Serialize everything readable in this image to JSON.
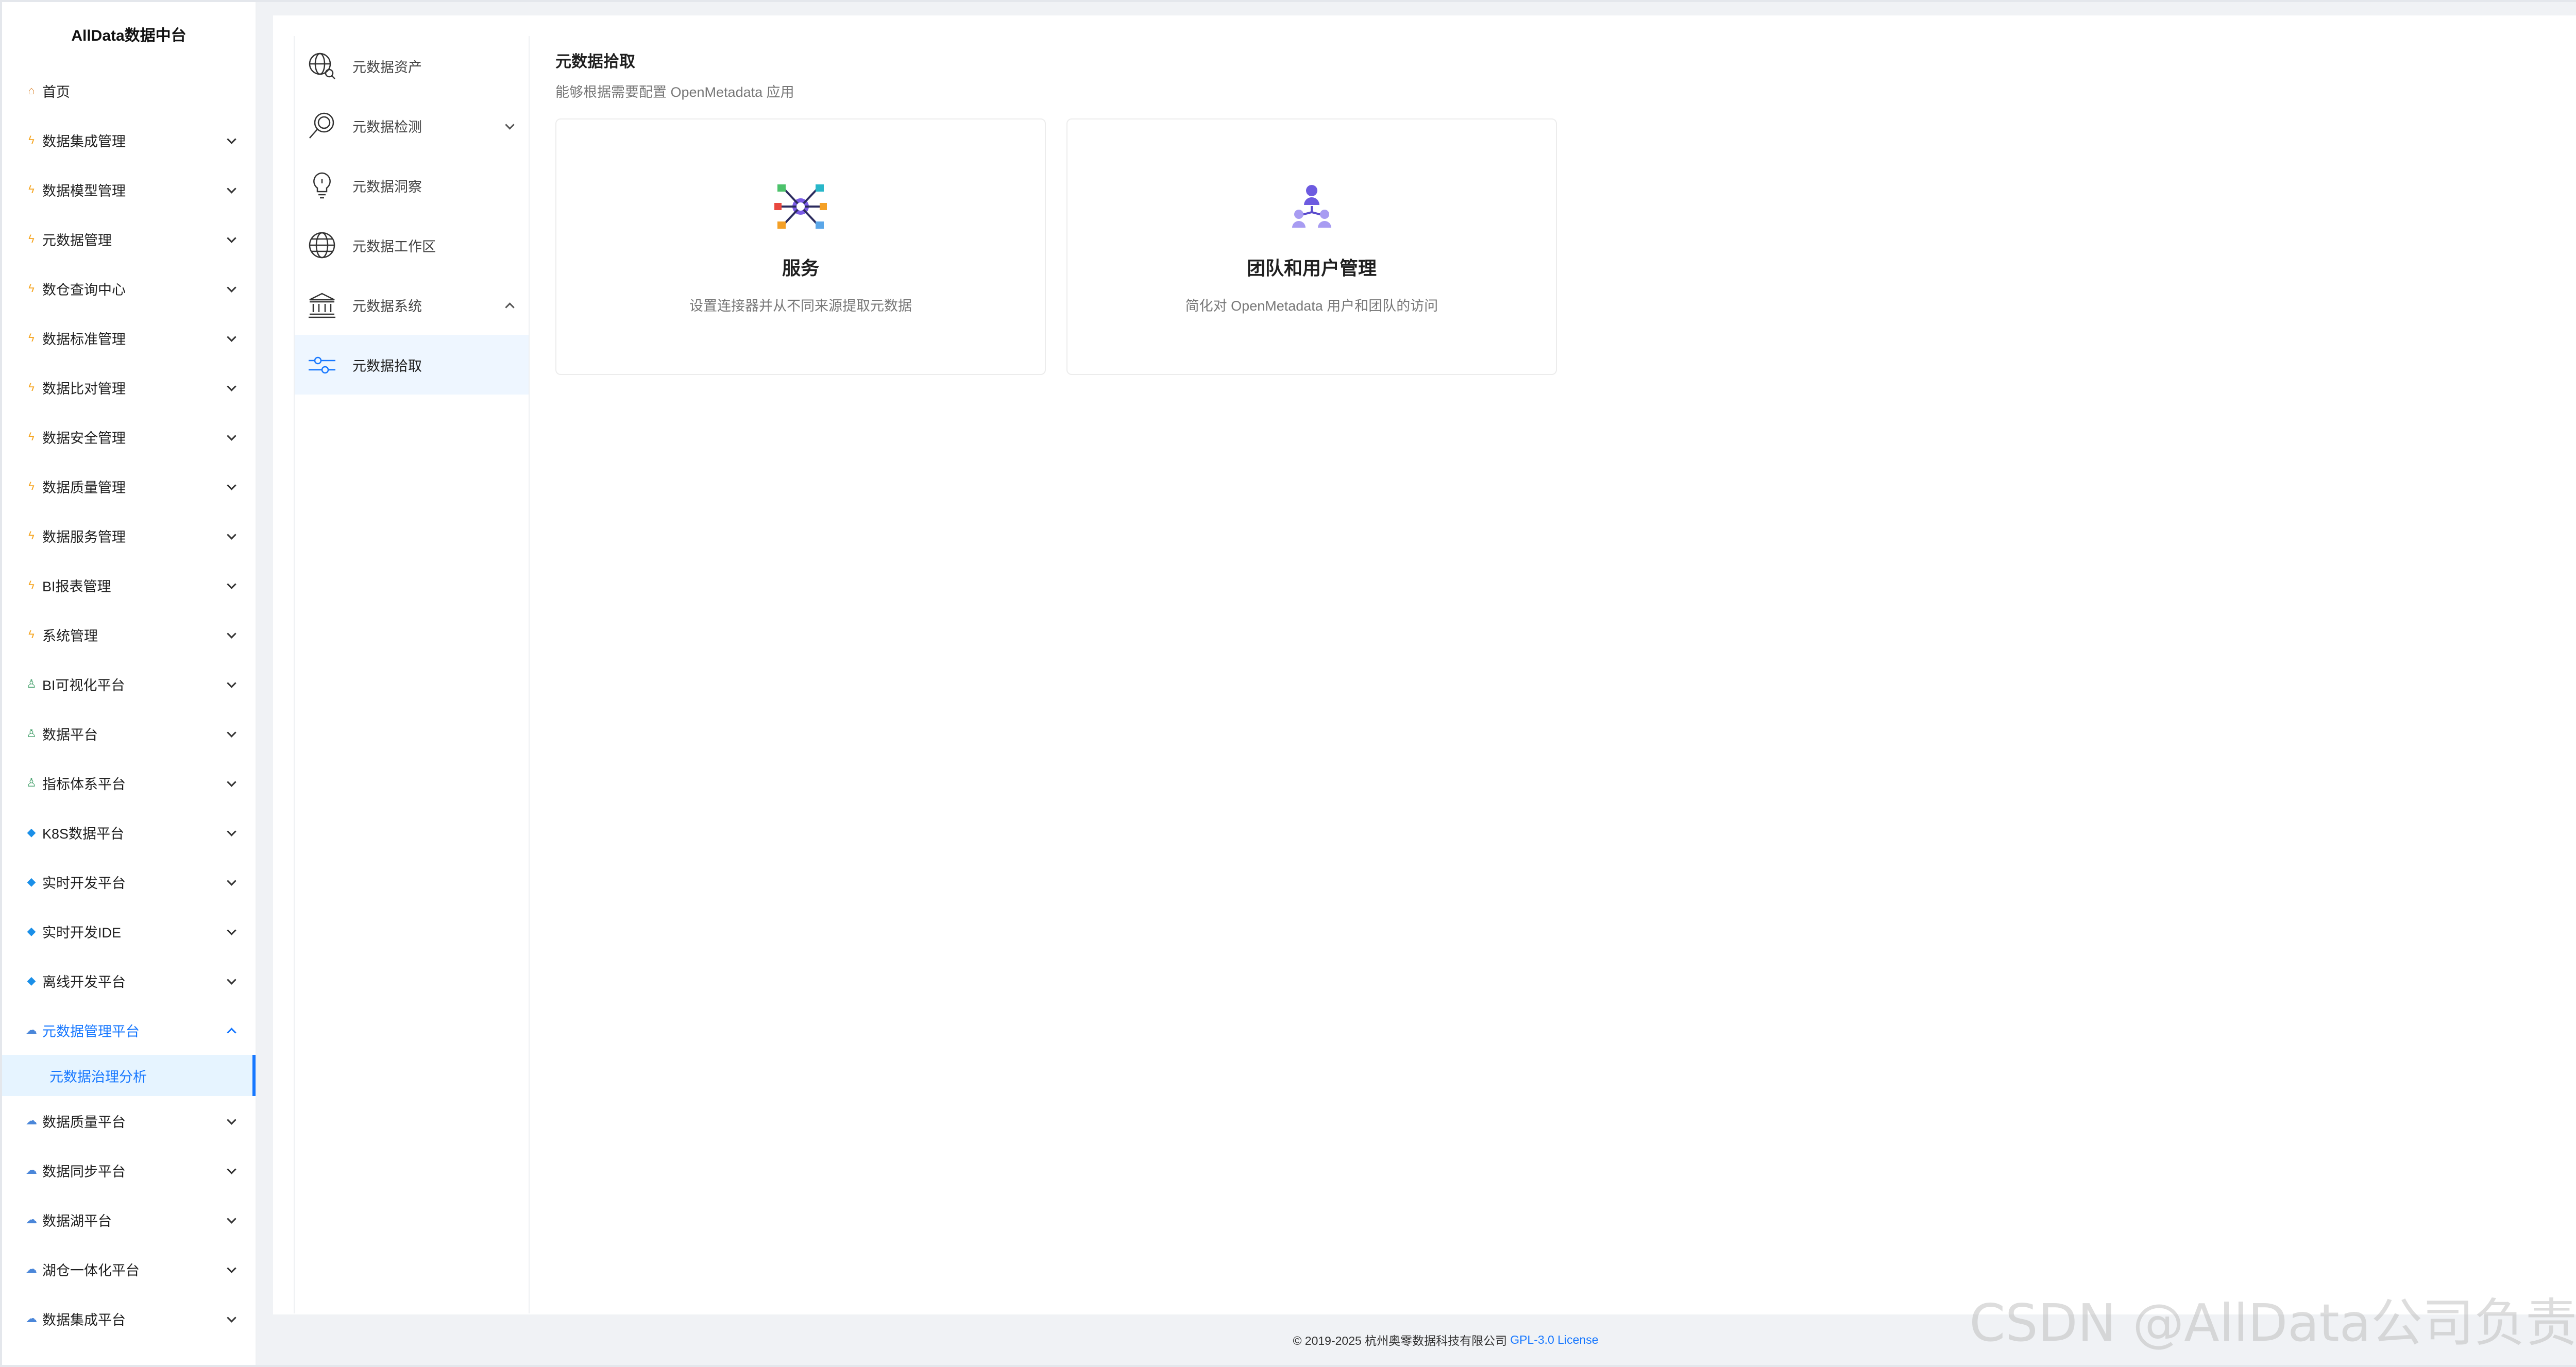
{
  "brand": "AllData数据中台",
  "sidebar": {
    "home": "首页",
    "items": [
      {
        "label": "数据集成管理",
        "icon": "bolt-icon"
      },
      {
        "label": "数据模型管理",
        "icon": "bolt-icon"
      },
      {
        "label": "元数据管理",
        "icon": "bolt-icon"
      },
      {
        "label": "数仓查询中心",
        "icon": "bolt-icon"
      },
      {
        "label": "数据标准管理",
        "icon": "bolt-icon"
      },
      {
        "label": "数据比对管理",
        "icon": "bolt-icon"
      },
      {
        "label": "数据安全管理",
        "icon": "bolt-icon"
      },
      {
        "label": "数据质量管理",
        "icon": "bolt-icon"
      },
      {
        "label": "数据服务管理",
        "icon": "bolt-icon"
      },
      {
        "label": "BI报表管理",
        "icon": "bolt-icon"
      },
      {
        "label": "系统管理",
        "icon": "bolt-icon"
      },
      {
        "label": "BI可视化平台",
        "icon": "person-icon"
      },
      {
        "label": "数据平台",
        "icon": "person-icon"
      },
      {
        "label": "指标体系平台",
        "icon": "person-icon"
      },
      {
        "label": "K8S数据平台",
        "icon": "gem-icon"
      },
      {
        "label": "实时开发平台",
        "icon": "gem-icon"
      },
      {
        "label": "实时开发IDE",
        "icon": "gem-icon"
      },
      {
        "label": "离线开发平台",
        "icon": "gem-icon"
      }
    ],
    "expanded": {
      "label": "元数据管理平台",
      "icon": "cloud-icon",
      "sub": "元数据治理分析"
    },
    "items_after": [
      {
        "label": "数据质量平台",
        "icon": "cloud-icon"
      },
      {
        "label": "数据同步平台",
        "icon": "cloud-icon"
      },
      {
        "label": "数据湖平台",
        "icon": "cloud-icon"
      },
      {
        "label": "湖仓一体化平台",
        "icon": "cloud-icon"
      },
      {
        "label": "数据集成平台",
        "icon": "cloud-icon"
      }
    ]
  },
  "subnav": [
    {
      "label": "元数据资产",
      "icon": "globe-search-icon"
    },
    {
      "label": "元数据检测",
      "icon": "magnifier-icon"
    },
    {
      "label": "元数据洞察",
      "icon": "lightbulb-icon"
    },
    {
      "label": "元数据工作区",
      "icon": "globe-icon"
    },
    {
      "label": "元数据系统",
      "icon": "bank-icon"
    },
    {
      "label": "元数据拾取",
      "icon": "sliders-icon"
    }
  ],
  "content": {
    "title": "元数据拾取",
    "subtitle": "能够根据需要配置 OpenMetadata 应用"
  },
  "cards": [
    {
      "title": "服务",
      "desc": "设置连接器并从不同来源提取元数据",
      "icon": "service-network-icon"
    },
    {
      "title": "团队和用户管理",
      "desc": "简化对 OpenMetadata 用户和团队的访问",
      "icon": "team-users-icon"
    }
  ],
  "footer": {
    "copyright": "© 2019-2025 杭州奥零数据科技有限公司",
    "license": "GPL-3.0 License"
  },
  "watermark": "CSDN @AllData公司负责人",
  "colors": {
    "accent": "#1677ff",
    "active_bg": "#e6f4ff"
  }
}
